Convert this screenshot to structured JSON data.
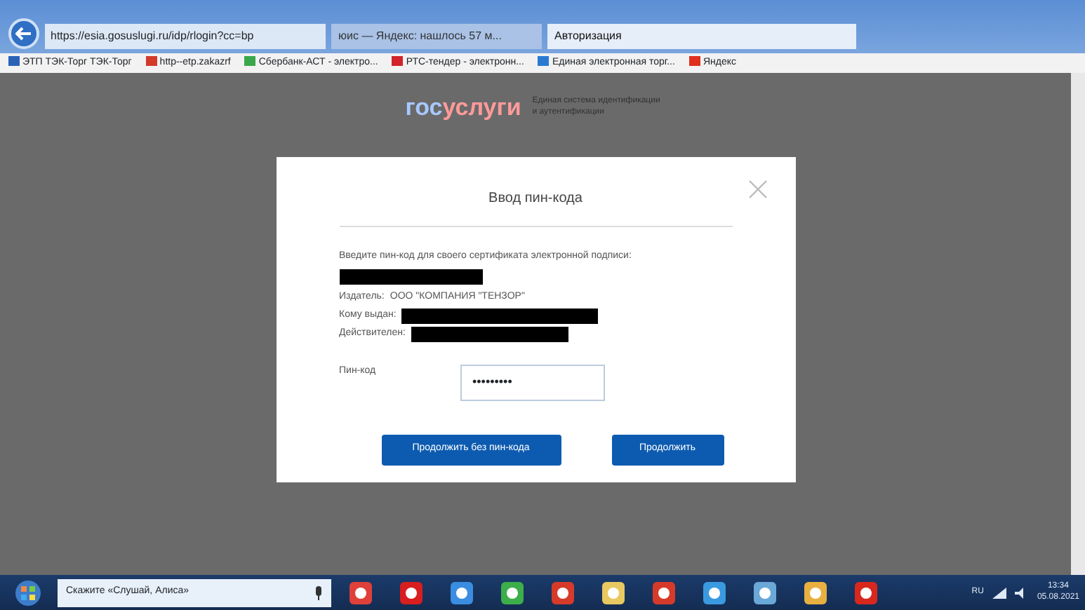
{
  "browser": {
    "address": "https://esia.gosuslugi.ru/idp/rlogin?cc=bp",
    "tabs": [
      {
        "label": "юис — Яндекс: нашлось 57 м...",
        "selected": false
      },
      {
        "label": "Авторизация",
        "selected": true
      }
    ],
    "favorites": [
      {
        "label": "ЭТП ТЭК-Торг ТЭК-Торг",
        "color": "#2a62b8"
      },
      {
        "label": "http--etp.zakazrf",
        "color": "#d23a2a"
      },
      {
        "label": "Сбербанк-АСТ - электро...",
        "color": "#3aa84a"
      },
      {
        "label": "РТС-тендер - электронн...",
        "color": "#d2222a"
      },
      {
        "label": "Единая электронная торг...",
        "color": "#2a7ad2"
      },
      {
        "label": "Яндекс",
        "color": "#e0301e"
      }
    ]
  },
  "logo": {
    "part_1": "гос",
    "part_2": "услуги",
    "tagline": "Единая система идентификации и аутентификации"
  },
  "dialog": {
    "title": "Ввод пин-кода",
    "prompt": "Введите пин-код для своего сертификата электронной подписи:",
    "fields": [
      {
        "label": "Издатель:",
        "value": "ООО \"КОМПАНИЯ \"ТЕНЗОР\""
      },
      {
        "label": "Кому выдан:"
      },
      {
        "label": "Действителен:"
      }
    ],
    "pin_label": "Пин-код",
    "pin_value": "•••••••••",
    "buttons": [
      "Продолжить без пин-кода",
      "Продолжить"
    ]
  },
  "taskbar": {
    "search": "Скажите «Слушай, Алиса»",
    "language": "RU",
    "time": "13:34",
    "date": "05.08.2021"
  }
}
